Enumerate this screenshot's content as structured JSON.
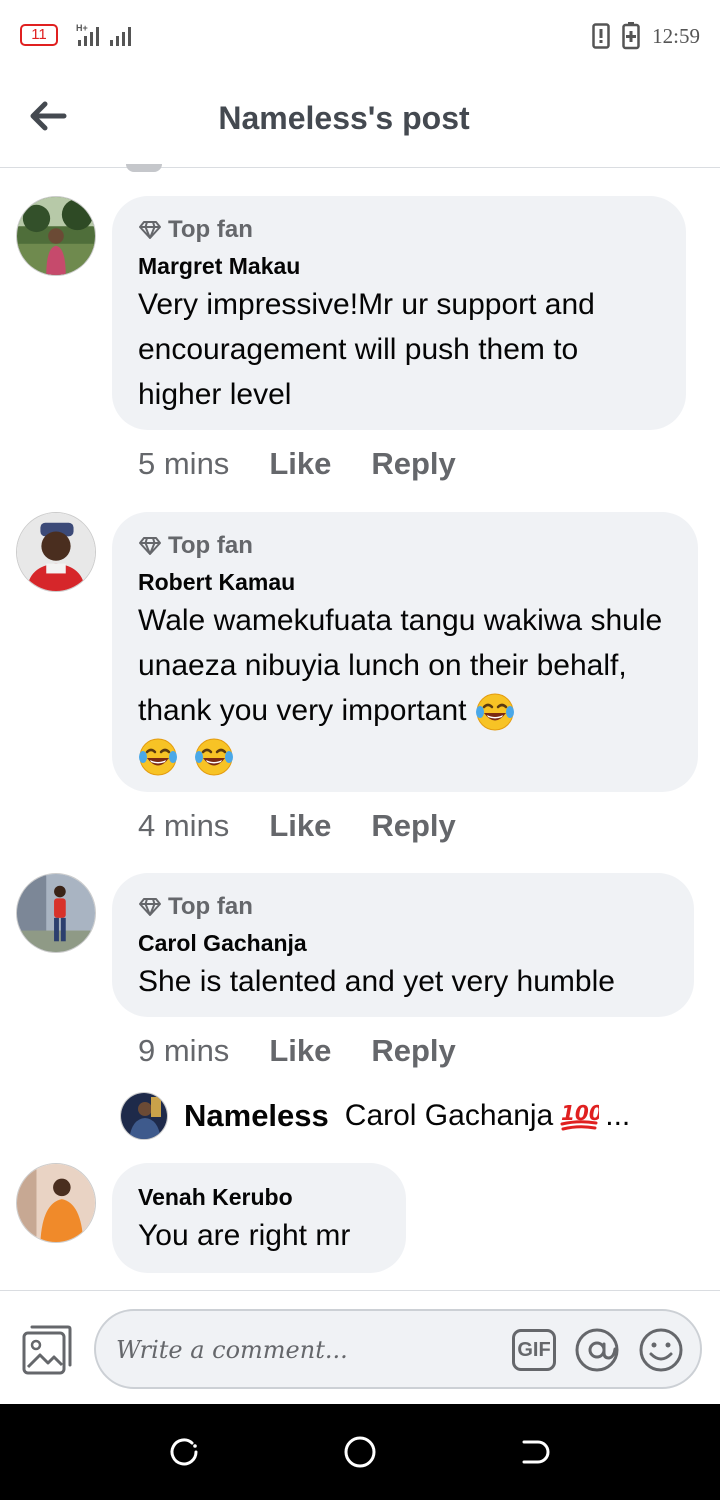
{
  "status_bar": {
    "notification_count": "11",
    "network": "H+",
    "time": "12:59",
    "icons": [
      "signal-icon",
      "phone-alert-icon",
      "battery-charging-icon"
    ]
  },
  "header": {
    "title": "Nameless's post",
    "back_icon": "arrow-left-icon"
  },
  "comments": [
    {
      "badge": "Top fan",
      "author": "Margret Makau",
      "text": "Very impressive!Mr ur support and encouragement will push them to higher level",
      "time": "5 mins",
      "like_label": "Like",
      "reply_label": "Reply"
    },
    {
      "badge": "Top fan",
      "author": "Robert Kamau",
      "text": "Wale wamekufuata tangu wakiwa shule unaeza nibuyia lunch on their behalf, thank you very important",
      "emojis": [
        "tears-of-joy-emoji",
        "tears-of-joy-emoji",
        "tears-of-joy-emoji"
      ],
      "time": "4 mins",
      "like_label": "Like",
      "reply_label": "Reply"
    },
    {
      "badge": "Top fan",
      "author": "Carol Gachanja",
      "text": "She is talented and yet very humble",
      "time": "9 mins",
      "like_label": "Like",
      "reply_label": "Reply",
      "reply_preview": {
        "author": "Nameless",
        "text": "Carol Gachanja",
        "emoji": "hundred-points-emoji",
        "ellipsis": "..."
      }
    },
    {
      "author": "Venah Kerubo",
      "text": "You are right mr"
    }
  ],
  "composer": {
    "placeholder": "Write a comment...",
    "value": "",
    "gif_label": "GIF",
    "icons": [
      "photo-icon",
      "at-sign-icon",
      "smiley-icon"
    ]
  },
  "nav_bar": {
    "icons": [
      "recents-icon",
      "home-icon",
      "back-icon"
    ]
  },
  "colors": {
    "bubble": "#f0f2f5",
    "secondary_text": "#65676b",
    "title_text": "#444950",
    "badge_red": "#e02020"
  }
}
